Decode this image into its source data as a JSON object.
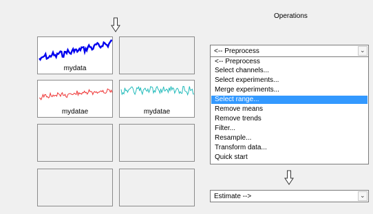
{
  "operations": {
    "heading": "Operations",
    "preprocess_select": {
      "value": "<-- Preprocess"
    },
    "options": [
      "<-- Preprocess",
      "Select channels...",
      "Select experiments...",
      "Merge experiments...",
      "Select range...",
      "Remove means",
      "Remove trends",
      "Filter...",
      "Resample...",
      "Transform data...",
      "Quick start"
    ],
    "selected_option": "Select range...",
    "estimate_select": {
      "value": "Estimate -->"
    }
  },
  "data_board": {
    "tiles": [
      {
        "label": "mydata",
        "line_color": "#0000ee",
        "filled": true
      },
      {
        "label": "",
        "filled": false
      },
      {
        "label": "mydatae",
        "line_color": "#ee3333",
        "filled": true
      },
      {
        "label": "mydatae",
        "line_color": "#22bbbb",
        "filled": true
      },
      {
        "label": "",
        "filled": false
      },
      {
        "label": "",
        "filled": false
      },
      {
        "label": "",
        "filled": false
      },
      {
        "label": "",
        "filled": false
      }
    ]
  },
  "icons": {
    "top_arrow": "down-arrow-icon",
    "middle_arrow": "down-arrow-icon",
    "dropdown_buttons": "chevron-down-icon"
  }
}
